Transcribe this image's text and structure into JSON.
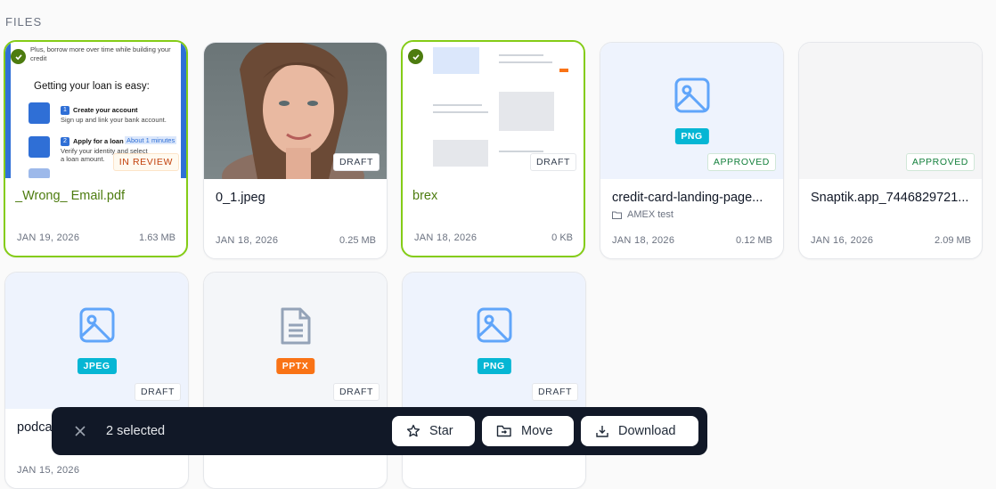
{
  "section_title": "FILES",
  "files": [
    {
      "name": "_Wrong_ Email.pdf",
      "date": "JAN 19, 2026",
      "size": "1.63 MB",
      "badge": "IN REVIEW",
      "selected": true
    },
    {
      "name": "0_1.jpeg",
      "date": "JAN 18, 2026",
      "size": "0.25 MB",
      "badge": "DRAFT",
      "selected": false
    },
    {
      "name": "brex",
      "date": "JAN 18, 2026",
      "size": "0 KB",
      "badge": "DRAFT",
      "selected": true
    },
    {
      "name": "credit-card-landing-page...",
      "folder": "AMEX test",
      "date": "JAN 18, 2026",
      "size": "0.12 MB",
      "badge": "APPROVED",
      "type": "PNG",
      "icon": "image-icon"
    },
    {
      "name": "Snaptik.app_7446829721...",
      "date": "JAN 16, 2026",
      "size": "2.09 MB",
      "badge": "APPROVED"
    },
    {
      "name": "podca",
      "date": "JAN 15, 2026",
      "badge": "DRAFT",
      "type": "JPEG",
      "icon": "image-icon"
    },
    {
      "badge": "DRAFT",
      "type": "PPTX",
      "icon": "document-icon"
    },
    {
      "badge": "DRAFT",
      "type": "PNG",
      "icon": "image-icon"
    }
  ],
  "loan_preview": {
    "intro": "Plus, borrow more over time while building your credit",
    "heading": "Getting your loan is easy:",
    "step1_title": "Create your account",
    "step1_text": "Sign up and link your bank account.",
    "step2_title": "Apply for a loan",
    "step2_tag": "About 1 minutes",
    "step2_text": "Verify your identity and select a loan amount."
  },
  "selection_bar": {
    "count_label": "2 selected",
    "star_label": "Star",
    "move_label": "Move",
    "download_label": "Download"
  },
  "colors": {
    "selected_border": "#84cc16",
    "selected_text": "#4d7c0f",
    "png_badge": "#06b6d4",
    "pptx_badge": "#f97316",
    "icon_blue": "#60a5fa",
    "bar_bg": "#111827"
  }
}
